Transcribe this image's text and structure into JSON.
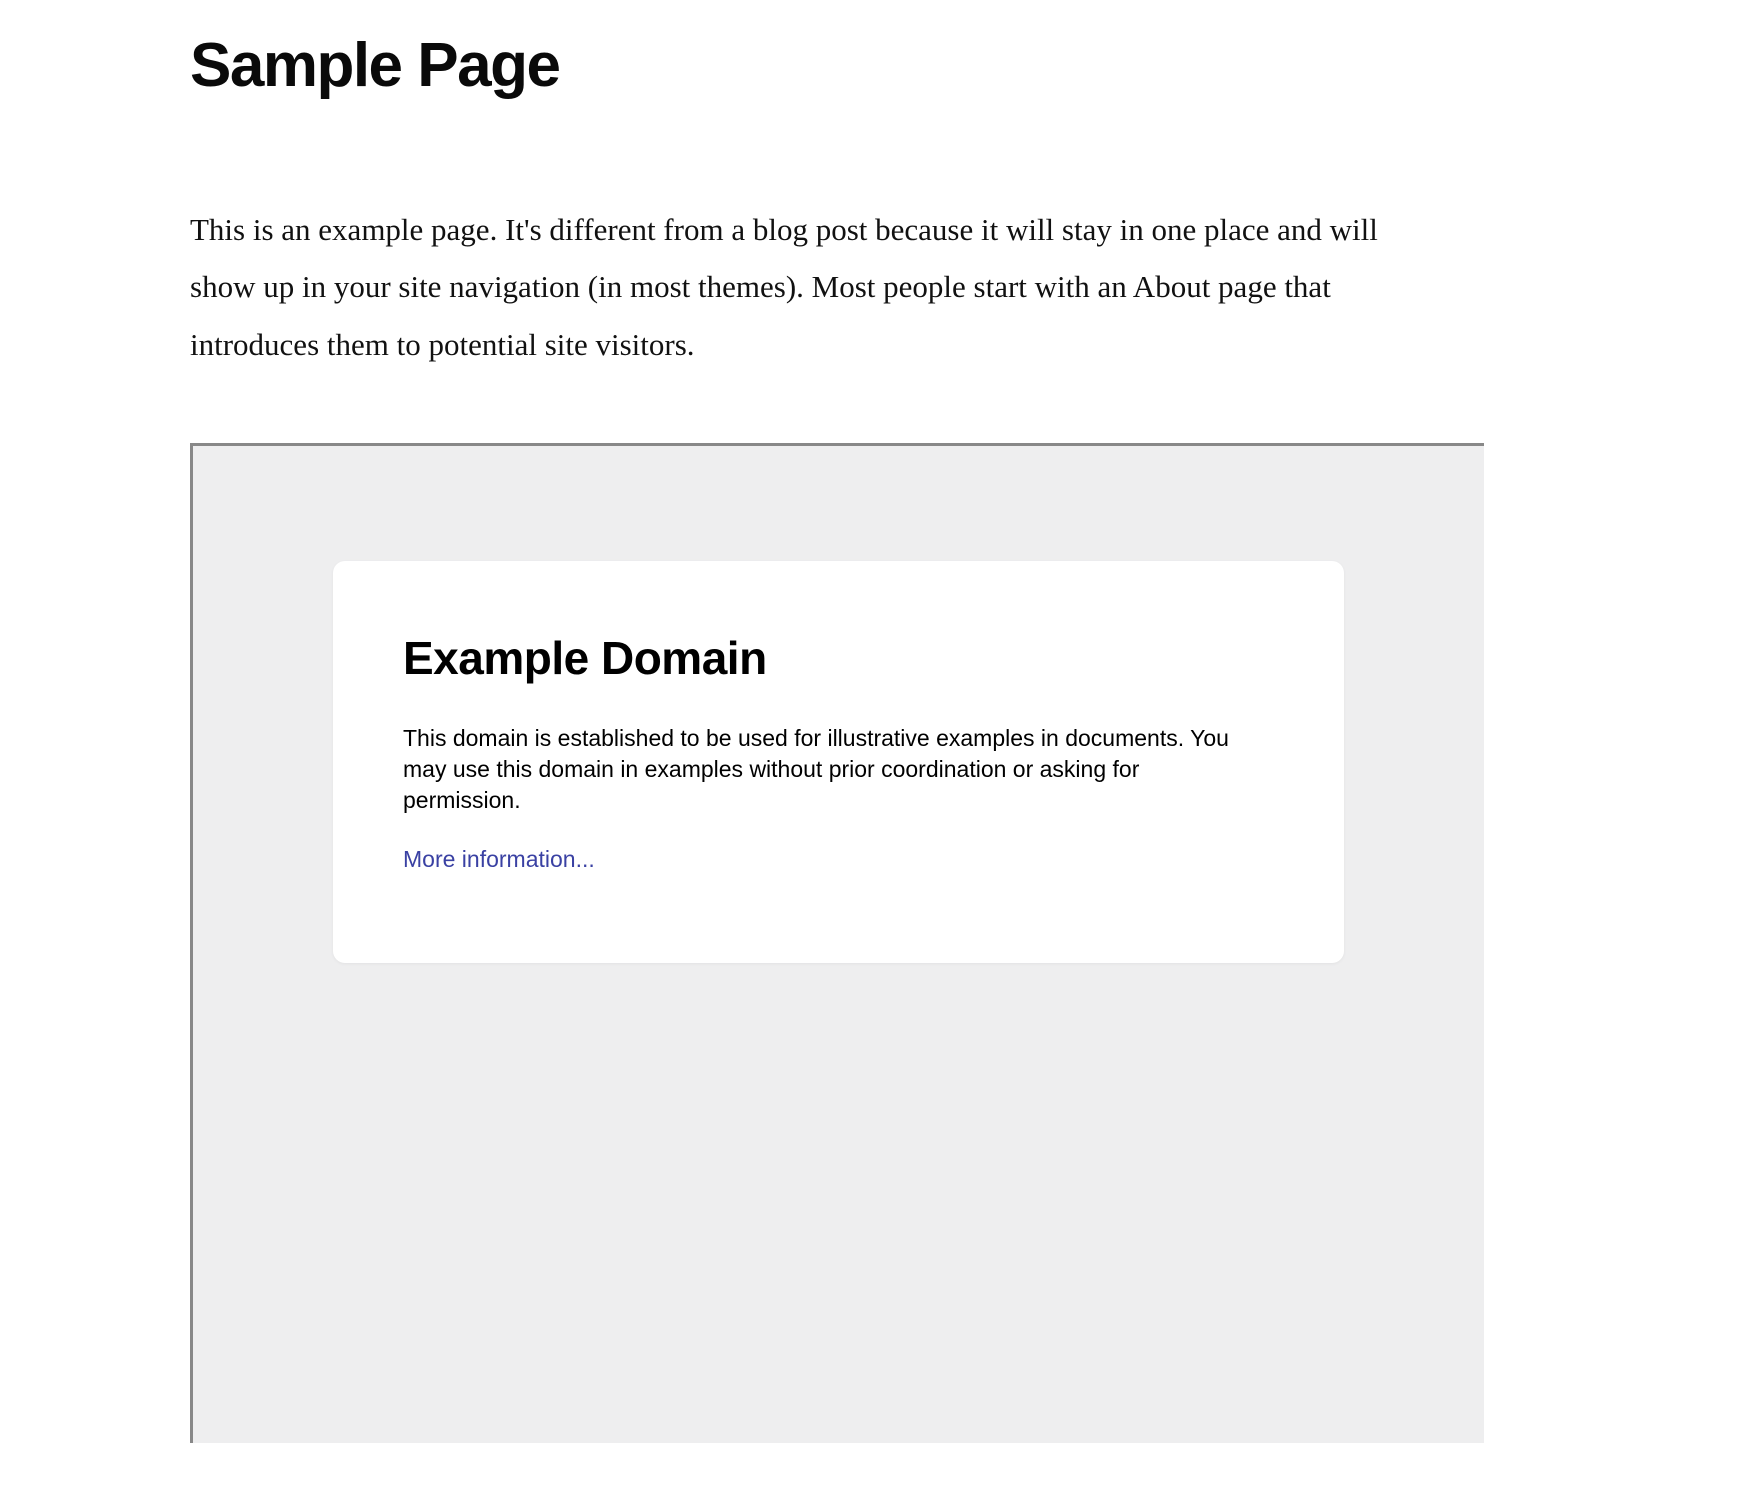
{
  "page": {
    "title": "Sample Page",
    "intro": "This is an example page. It's different from a blog post because it will stay in one place and will show up in your site navigation (in most themes). Most people start with an About page that introduces them to potential site visitors."
  },
  "embedded": {
    "title": "Example Domain",
    "body": "This domain is established to be used for illustrative examples in documents. You may use this domain in examples without prior coordination or asking for permission.",
    "link_text": "More information..."
  }
}
